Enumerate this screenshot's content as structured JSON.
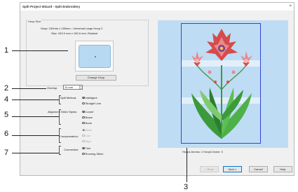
{
  "window": {
    "title": "Split Project Wizard - Split Embroidery",
    "close_glyph": "×"
  },
  "hoop": {
    "group_label": "Hoop Size",
    "line1": "Hoop: 240mm x 150mm - Universal Large Hoop 2",
    "line2": "Size: 240.0 mm x 150.0 mm, Rotated",
    "change_label": "Change Hoop"
  },
  "overlap": {
    "label": "Overlap:",
    "value": "10 mm"
  },
  "split_method": {
    "label": "Split Method:",
    "options": [
      {
        "label": "Intelligent",
        "selected": true
      },
      {
        "label": "Straight Line",
        "selected": false
      }
    ]
  },
  "alignment": {
    "label": "Alignment Stitch Styles:",
    "options": [
      {
        "label": "Corner",
        "selected": true
      },
      {
        "label": "Brace",
        "selected": false
      },
      {
        "label": "None",
        "selected": false
      }
    ]
  },
  "compensation": {
    "label": "Compensation:",
    "options": [
      {
        "label": "None",
        "selected": true
      },
      {
        "label": "Low",
        "selected": false
      },
      {
        "label": "High",
        "selected": false
      }
    ]
  },
  "connection": {
    "label": "Connection:",
    "options": [
      {
        "label": "Trim",
        "selected": true
      },
      {
        "label": "Running Stitch",
        "selected": false
      }
    ]
  },
  "preview": {
    "status": "Hoops Across: 1  Hoops Down: 3"
  },
  "buttons": {
    "back": "< Back",
    "next": "Next >",
    "cancel": "Cancel",
    "help": "Help"
  },
  "callouts": {
    "c1": "1",
    "c2": "2",
    "c3": "3",
    "c4": "4",
    "c5": "5",
    "c6": "6",
    "c7": "7"
  },
  "colors": {
    "preview_bg": "#bedcf4",
    "hoop_outline": "#3346d6",
    "flower_red": "#d64b4b",
    "flower_pink": "#e98a8a",
    "leaf_green": "#3d9a3a"
  }
}
